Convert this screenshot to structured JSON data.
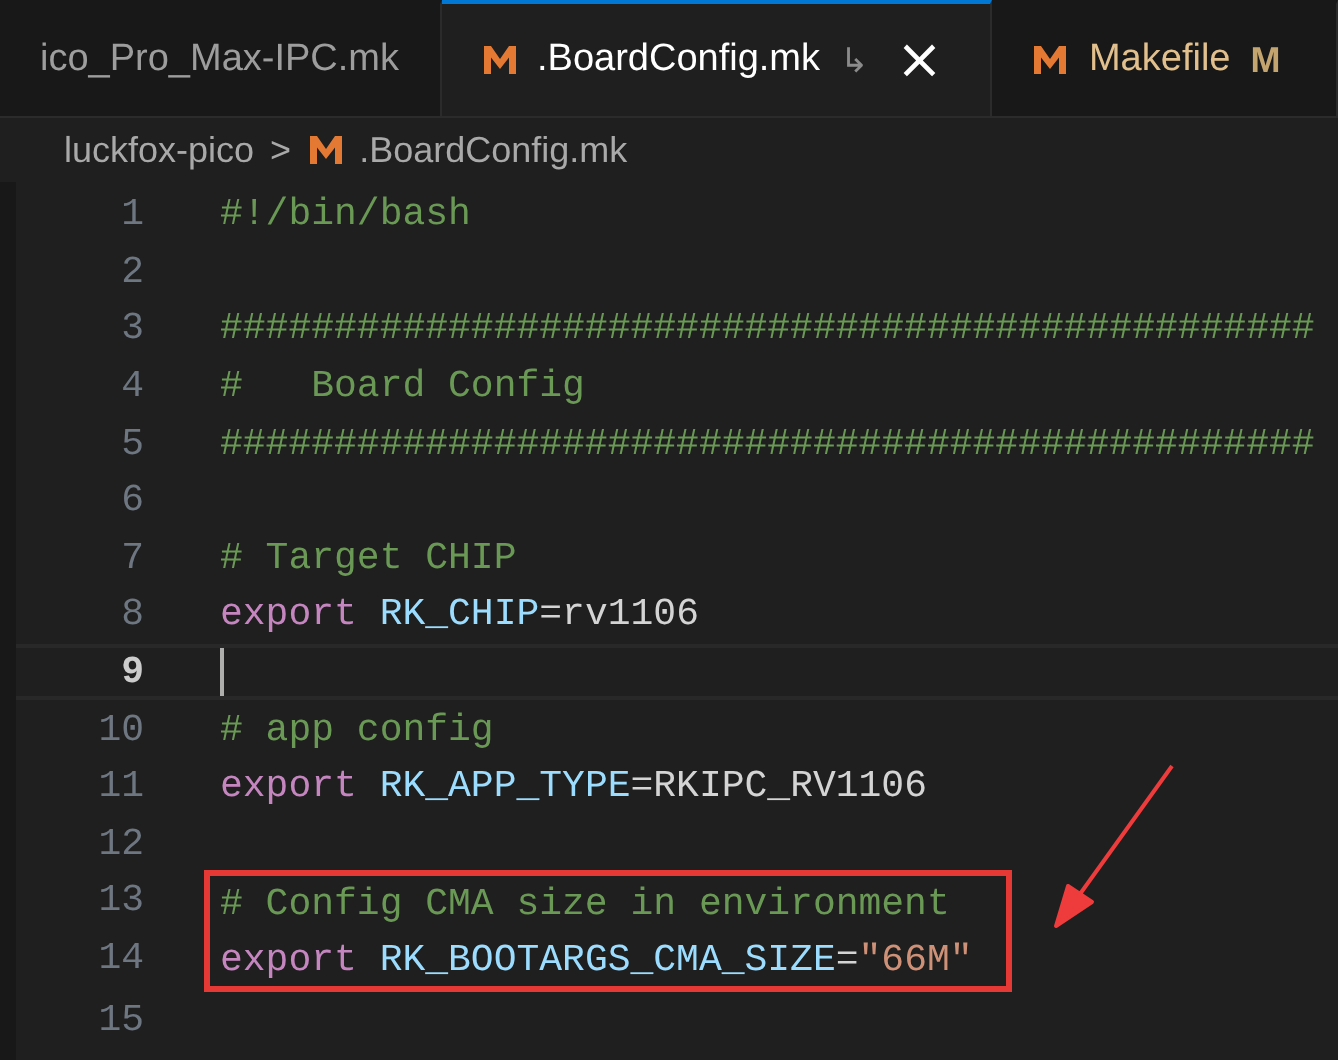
{
  "tabs": [
    {
      "label": "ico_Pro_Max-IPC.mk",
      "icon": false,
      "selected": false
    },
    {
      "label": ".BoardConfig.mk",
      "icon": true,
      "selected": true,
      "symlink": "↳",
      "close": "×"
    },
    {
      "label": "Makefile",
      "icon": true,
      "selected": false,
      "git_status": "M"
    }
  ],
  "breadcrumb": {
    "folder": "luckfox-pico",
    "separator": ">",
    "file": ".BoardConfig.mk"
  },
  "lines": [
    {
      "number": "1",
      "current": false,
      "boxed": false,
      "tokens": [
        {
          "kind": "comment",
          "text": "#!/bin/bash"
        }
      ]
    },
    {
      "number": "2",
      "current": false,
      "boxed": false
    },
    {
      "number": "3",
      "current": false,
      "boxed": false,
      "tokens": [
        {
          "kind": "comment",
          "text": "################################################"
        }
      ]
    },
    {
      "number": "4",
      "current": false,
      "boxed": false,
      "tokens": [
        {
          "kind": "comment",
          "text": "#   Board Config"
        }
      ]
    },
    {
      "number": "5",
      "current": false,
      "boxed": false,
      "tokens": [
        {
          "kind": "comment",
          "text": "################################################"
        }
      ]
    },
    {
      "number": "6",
      "current": false,
      "boxed": false
    },
    {
      "number": "7",
      "current": false,
      "boxed": false,
      "tokens": [
        {
          "kind": "comment",
          "text": "# Target CHIP"
        }
      ]
    },
    {
      "number": "8",
      "current": false,
      "boxed": false,
      "tokens": [
        {
          "kind": "keyword",
          "text": "export"
        },
        {
          "kind": "variable",
          "text": "RK_CHIP"
        },
        {
          "kind": "plain",
          "text": "=rv1106"
        }
      ]
    },
    {
      "number": "9",
      "current": true,
      "boxed": false
    },
    {
      "number": "10",
      "current": false,
      "boxed": false,
      "tokens": [
        {
          "kind": "comment",
          "text": "# app config"
        }
      ]
    },
    {
      "number": "11",
      "current": false,
      "boxed": false,
      "tokens": [
        {
          "kind": "keyword",
          "text": "export"
        },
        {
          "kind": "variable",
          "text": "RK_APP_TYPE"
        },
        {
          "kind": "plain",
          "text": "=RKIPC_RV1106"
        }
      ]
    },
    {
      "number": "12",
      "current": false,
      "boxed": false
    },
    {
      "number": "13",
      "current": false,
      "boxed": true,
      "tokens": [
        {
          "kind": "comment",
          "text": "# Config CMA size in environment"
        }
      ]
    },
    {
      "number": "14",
      "current": false,
      "boxed": true,
      "tokens": [
        {
          "kind": "keyword",
          "text": "export"
        },
        {
          "kind": "variable",
          "text": "RK_BOOTARGS_CMA_SIZE"
        },
        {
          "kind": "plain",
          "text": "="
        },
        {
          "kind": "string",
          "text": "\"66M\""
        }
      ]
    },
    {
      "number": "15",
      "current": false,
      "boxed": false
    }
  ]
}
